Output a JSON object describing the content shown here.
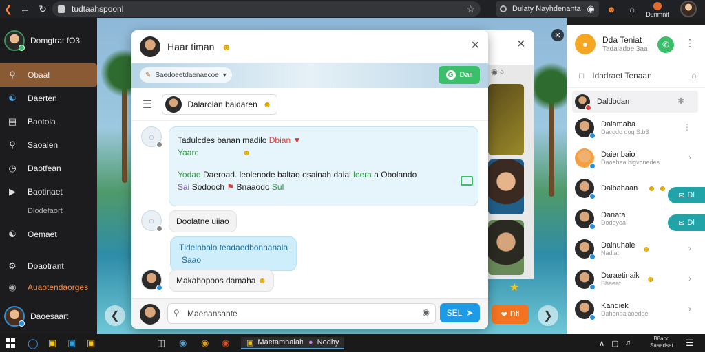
{
  "browser": {
    "url": "tudtaahspoonl",
    "extension_label": "Dulaty Nayhdenanta",
    "user_label": "Dunmnit"
  },
  "sidebar": {
    "profile_name": "Domgtrat fO3",
    "items": [
      {
        "label": "Obaal",
        "icon": "search-icon"
      },
      {
        "label": "Daerten",
        "icon": "people-icon"
      },
      {
        "label": "Baotola",
        "icon": "chart-icon"
      },
      {
        "label": "Saoalen",
        "icon": "magnify-icon"
      },
      {
        "label": "Daotfean",
        "icon": "clock-icon"
      },
      {
        "label": "Baotinaet",
        "icon": "media-icon"
      },
      {
        "label": "Oemaet",
        "icon": "people-icon"
      },
      {
        "label": "Doaotrant",
        "icon": "gear-icon"
      }
    ],
    "sub_item": "Dlodefaort",
    "orange_item": "Auaotendaorges",
    "bottom_name": "Daoesaart"
  },
  "chat": {
    "title": "Haar timan",
    "search_placeholder": "Saedoeetdaenaecoe",
    "green_pill": "Daii",
    "contact": "Dalarolan baidaren",
    "messages": {
      "big_line1": "Tadulcdes banan madilo",
      "big_tag": "Dbian",
      "big_line2": "Yaarc",
      "big_line3_a": "Yodao",
      "big_line3_b": "Daeroad. leolenode baltao osainah",
      "big_line3_c": "daiai",
      "big_line3_d": "leera",
      "big_line3_e": "a Obolando",
      "big_line4_a": "Sai",
      "big_line4_b": "Sodooch",
      "big_line4_c": "Bnaaodo",
      "big_line4_d": "Sul",
      "grey1": "Doolatne uiiao",
      "blue1_line1": "Tldelnbalo teadaedbonnanala",
      "blue1_line2": "Saao",
      "grey2": "Makahopoos damaha"
    },
    "composer_placeholder": "Maenansante",
    "send_label": "SEL",
    "orange_label": "Dfl"
  },
  "right_panel": {
    "title": "Dda Teniat",
    "subtitle": "Tadaladoe 3aa",
    "tab_label": "Idadraet Tenaan",
    "contacts": [
      {
        "name": "Daldodan",
        "sub": ""
      },
      {
        "name": "Dalamaba",
        "sub": "Dacodo dog S.b3"
      },
      {
        "name": "Daienbaio",
        "sub": "Daoehaa bigvonedes"
      },
      {
        "name": "Dalbahaan",
        "sub": ""
      },
      {
        "name": "Danata",
        "sub": "Dodoyoa"
      },
      {
        "name": "Dalnuhale",
        "sub": "Nadiat"
      },
      {
        "name": "Daraetinaik",
        "sub": "Bhaeat"
      },
      {
        "name": "Kandiek",
        "sub": "Dahanbaiaoedoe"
      }
    ],
    "teal1": "Dl",
    "teal2": "Dl"
  },
  "taskbar": {
    "app1": "Maetamnaiah",
    "app2": "Nodhy",
    "clock_line1": "B8aod",
    "clock_line2": "Saaadsat"
  },
  "colors": {
    "accent_orange": "#f27420",
    "accent_blue": "#1e9be6",
    "accent_green": "#3bbf6a",
    "sidebar_active": "#8a5a35",
    "teal": "#21a3a8"
  }
}
